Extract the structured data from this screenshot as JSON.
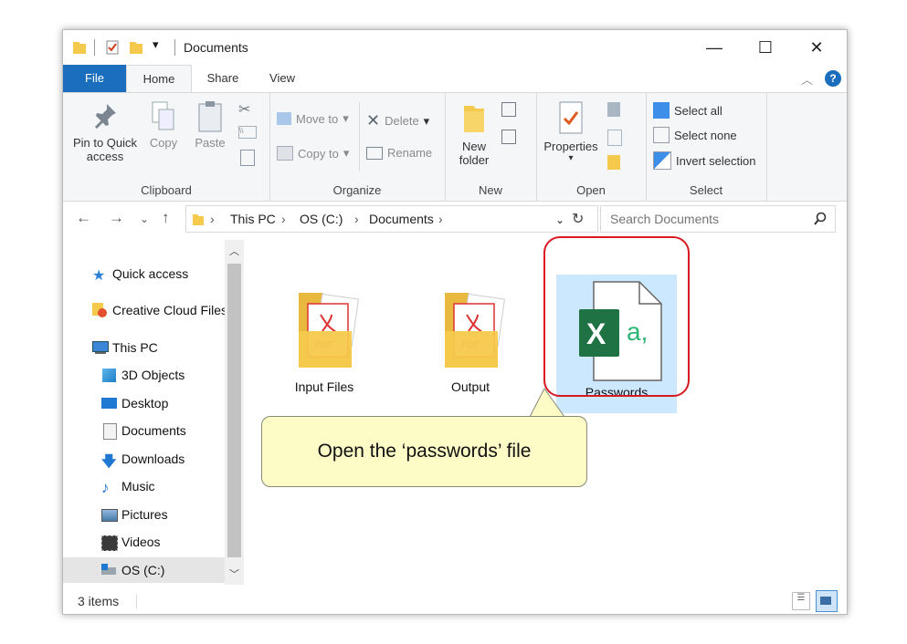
{
  "window": {
    "title": "Documents",
    "controls": {
      "minimize": "—",
      "maximize": "☐",
      "close": "✕"
    }
  },
  "tabs": [
    {
      "label": "File"
    },
    {
      "label": "Home"
    },
    {
      "label": "Share"
    },
    {
      "label": "View"
    }
  ],
  "ribbon": {
    "clipboard": {
      "label": "Clipboard",
      "pin_line1": "Pin to Quick",
      "pin_line2": "access",
      "copy": "Copy",
      "paste": "Paste"
    },
    "organize": {
      "label": "Organize",
      "move_to": "Move to",
      "copy_to": "Copy to",
      "delete": "Delete",
      "rename": "Rename"
    },
    "new": {
      "label": "New",
      "new_folder_line1": "New",
      "new_folder_line2": "folder"
    },
    "open": {
      "label": "Open",
      "properties": "Properties"
    },
    "select": {
      "label": "Select",
      "select_all": "Select all",
      "select_none": "Select none",
      "invert_selection": "Invert selection"
    }
  },
  "address": {
    "crumbs": [
      "This PC",
      "OS (C:)",
      "Documents"
    ],
    "search_placeholder": "Search Documents"
  },
  "nav": {
    "items": [
      {
        "label": "Quick access",
        "icon": "star-icon"
      },
      {
        "label": "Creative Cloud Files",
        "icon": "creative-cloud-icon"
      },
      {
        "label": "This PC",
        "icon": "computer-icon"
      },
      {
        "label": "3D Objects",
        "icon": "cube-icon"
      },
      {
        "label": "Desktop",
        "icon": "desktop-icon"
      },
      {
        "label": "Documents",
        "icon": "documents-icon"
      },
      {
        "label": "Downloads",
        "icon": "download-icon"
      },
      {
        "label": "Music",
        "icon": "music-icon"
      },
      {
        "label": "Pictures",
        "icon": "pictures-icon"
      },
      {
        "label": "Videos",
        "icon": "videos-icon"
      },
      {
        "label": "OS (C:)",
        "icon": "drive-icon"
      }
    ]
  },
  "files": [
    {
      "name": "Input Files",
      "type": "folder"
    },
    {
      "name": "Output",
      "type": "folder"
    },
    {
      "name": "Passwords",
      "type": "excel"
    }
  ],
  "status": {
    "count": "3 items"
  },
  "callout": {
    "text": "Open the ‘passwords’ file"
  },
  "colors": {
    "accent": "#1a6ebd",
    "highlight": "#d71920",
    "callout_bg": "#fdfbc6",
    "selection": "#cce8ff",
    "excel": "#1f7244",
    "folder": "#f5c94c"
  }
}
